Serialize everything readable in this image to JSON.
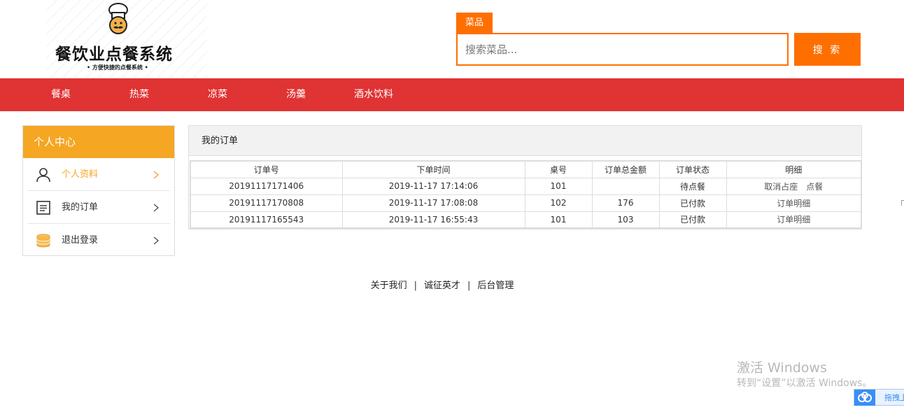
{
  "header": {
    "logo_title": "餐饮业点餐系统",
    "logo_subtitle": "• 方便快捷的点餐系统 •",
    "search_tab_label": "菜品",
    "search_placeholder": "搜索菜品...",
    "search_button_label": "搜 索"
  },
  "nav": {
    "items": [
      {
        "label": "餐桌"
      },
      {
        "label": "热菜"
      },
      {
        "label": "凉菜"
      },
      {
        "label": "汤羹"
      },
      {
        "label": "酒水饮料"
      }
    ]
  },
  "sidebar": {
    "title": "个人中心",
    "items": [
      {
        "label": "个人资料",
        "icon": "user-icon",
        "active": true
      },
      {
        "label": "我的订单",
        "icon": "order-list-icon",
        "active": false
      },
      {
        "label": "退出登录",
        "icon": "coins-icon",
        "active": false
      }
    ]
  },
  "orders": {
    "title": "我的订单",
    "columns": [
      "订单号",
      "下单时间",
      "桌号",
      "订单总金额",
      "订单状态",
      "明细"
    ],
    "rows": [
      {
        "order_no": "20191117171406",
        "time": "2019-11-17 17:14:06",
        "table": "101",
        "amount": "",
        "status": "待点餐",
        "actions": [
          "取消占座",
          "点餐"
        ]
      },
      {
        "order_no": "20191117170808",
        "time": "2019-11-17 17:08:08",
        "table": "102",
        "amount": "176",
        "status": "已付款",
        "actions": [
          "订单明细"
        ]
      },
      {
        "order_no": "20191117165543",
        "time": "2019-11-17 16:55:43",
        "table": "101",
        "amount": "103",
        "status": "已付款",
        "actions": [
          "订单明细"
        ]
      }
    ]
  },
  "footer": {
    "links": [
      "关于我们",
      "诚征英才",
      "后台管理"
    ],
    "separator": "|"
  },
  "watermark": {
    "title": "激活 Windows",
    "subtitle": "转到“设置”以激活 Windows。"
  },
  "drag_bar": {
    "label": "拖拽上"
  },
  "colors": {
    "accent_orange": "#ff6f00",
    "nav_red": "#e03333",
    "sidebar_gold": "#f5a623"
  }
}
